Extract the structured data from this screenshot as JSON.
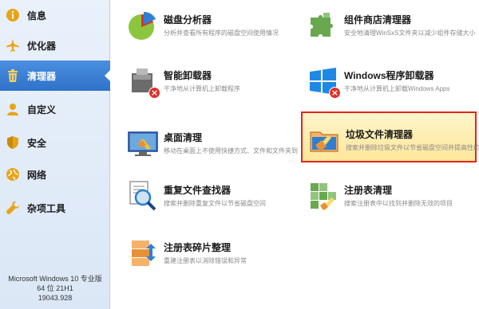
{
  "sidebar": {
    "items": [
      {
        "label": "信息",
        "icon": "info-icon"
      },
      {
        "label": "优化器",
        "icon": "airplane-icon"
      },
      {
        "label": "清理器",
        "icon": "trash-icon",
        "active": true
      },
      {
        "label": "自定义",
        "icon": "user-icon"
      },
      {
        "label": "安全",
        "icon": "shield-icon"
      },
      {
        "label": "网络",
        "icon": "globe-icon"
      },
      {
        "label": "杂项工具",
        "icon": "wrench-icon"
      }
    ],
    "system_info": {
      "line1": "Microsoft Windows 10 专业版",
      "line2": "64 位 21H1",
      "line3": "19043.928"
    }
  },
  "tools": {
    "disk_analyzer": {
      "name": "磁盘分析器",
      "desc": "分析并查看所有程序的磁盘空间使用情况"
    },
    "component_cleaner": {
      "name": "组件商店清理器",
      "desc": "安全地清理WinSxS文件夹以减少组件存储大小"
    },
    "smart_uninstaller": {
      "name": "智能卸载器",
      "desc": "干净地从计算机上卸载程序"
    },
    "windows_uninstaller": {
      "name": "Windows程序卸载器",
      "desc": "干净地从计算机上卸载Windows Apps"
    },
    "desktop_cleaner": {
      "name": "桌面清理",
      "desc": "移动在桌面上不使用快捷方式、文件和文件夹到"
    },
    "junk_cleaner": {
      "name": "垃圾文件清理器",
      "desc": "搜索并删除垃圾文件以节省磁盘空间并提高性能"
    },
    "duplicate_finder": {
      "name": "重复文件查找器",
      "desc": "搜索并删除重复文件以节省磁盘空间"
    },
    "registry_cleaner": {
      "name": "注册表清理",
      "desc": "搜索注册表中以找到并删除无效的项目"
    },
    "registry_defrag": {
      "name": "注册表碎片整理",
      "desc": "重建注册表以消除错误和异常"
    }
  },
  "colors": {
    "sidebar_active": "#3a80d6",
    "highlight_border": "#e3261b",
    "highlight_bg": "#fdeaa6"
  }
}
